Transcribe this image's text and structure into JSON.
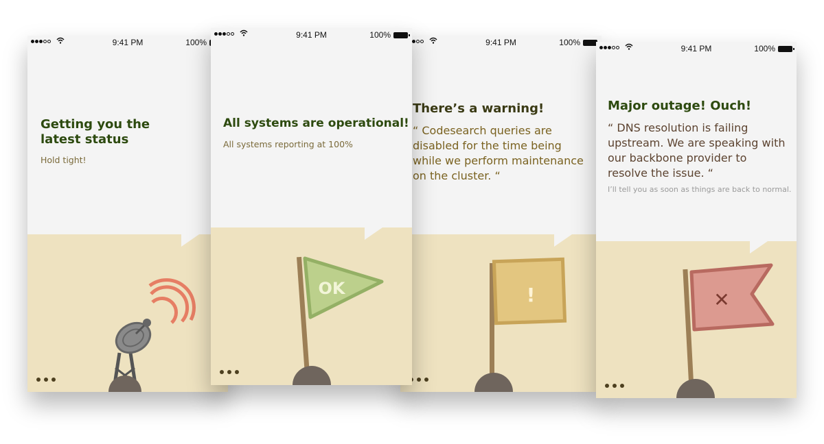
{
  "status_bar": {
    "time": "9:41 PM",
    "battery": "100%"
  },
  "screens": [
    {
      "title": "Getting you the latest status",
      "subtitle": "Hold tight!"
    },
    {
      "title": "All systems are operational!",
      "subtitle": "All systems reporting at 100%",
      "flag_label": "OK"
    },
    {
      "title": "There’s a warning!",
      "quote": "“ Codesearch queries are disabled for the time being while we perform maintenance on the cluster. “",
      "flag_label": "!"
    },
    {
      "title": "Major outage! Ouch!",
      "quote": "“ DNS resolution is failing upstream. We are speaking with our backbone provider to resolve the issue. “",
      "note": "I’ll tell you as soon as things are back to normal.",
      "flag_label": "✕"
    }
  ],
  "colors": {
    "ground": "#eee2c0",
    "title": "#2d4a0f",
    "ok_flag": "#bcd08c",
    "warn_flag": "#e3c680",
    "error_flag": "#dc9a90"
  },
  "icons": [
    "satellite-dish-icon",
    "ok-flag-icon",
    "warning-flag-icon",
    "error-flag-icon",
    "page-dots-icon"
  ]
}
